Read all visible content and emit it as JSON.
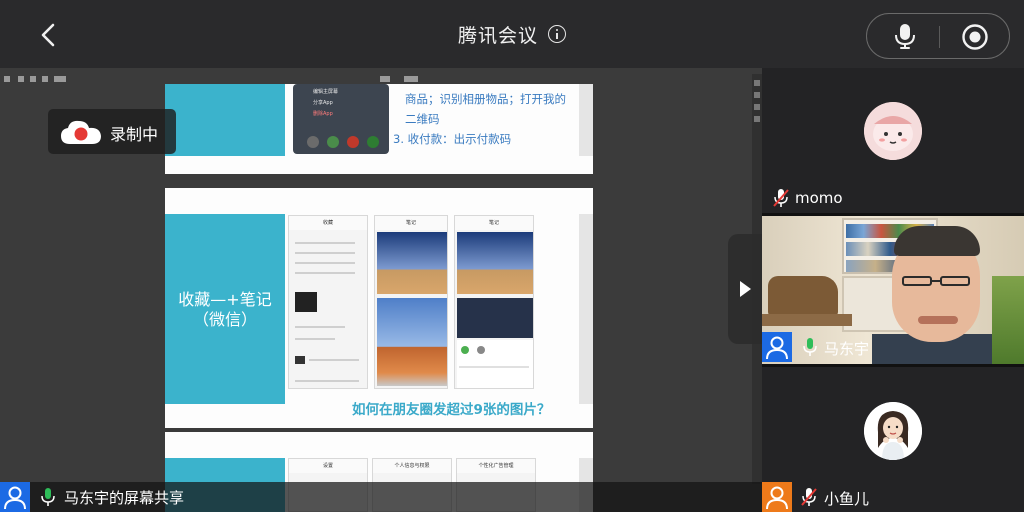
{
  "header": {
    "title": "腾讯会议",
    "back_icon": "chevron-left-icon",
    "info_icon": "info-icon",
    "mic_icon": "microphone-icon",
    "record_icon": "record-stop-icon"
  },
  "recording": {
    "label": "录制中",
    "icon": "recording-cloud-icon",
    "accent": "#e53935"
  },
  "shared_slides": {
    "slide1": {
      "text_lines": [
        "商品；识别相册物品；打开我的",
        "二维码",
        "3. 收付款：出示付款码"
      ],
      "menu_items": [
        "编辑主屏幕",
        "分享App",
        "删除App"
      ]
    },
    "slide2": {
      "band_title_line1": "收藏—+笔记",
      "band_title_line2": "（微信）",
      "question": "如何在朋友圈发超过9张的图片？",
      "screen_headers": [
        "收藏",
        "笔记",
        "笔记"
      ]
    },
    "slide3": {
      "screen_headers": [
        "设置",
        "个人信息与权限",
        "个性化广告管理"
      ]
    },
    "accent_band": "#3bb3cc",
    "text_color": "#3a7bc0"
  },
  "share_bar": {
    "label": "马东宇的屏幕共享",
    "avatar_icon": "user-avatar-icon",
    "mic_icon": "microphone-on-icon"
  },
  "participants": [
    {
      "name": "momo",
      "mic_icon": "microphone-muted-icon",
      "avatar": "cartoon-avatar"
    },
    {
      "name": "马东宇",
      "mic_icon": "microphone-on-icon",
      "avatar": "user-avatar-icon",
      "video": true
    },
    {
      "name": "小鱼儿",
      "mic_icon": "microphone-muted-icon",
      "avatar": "cartoon-avatar"
    }
  ],
  "colors": {
    "topbar": "#2a2a2c",
    "blue_avatar": "#1c6ae4",
    "orange_avatar": "#ee7a1a",
    "mic_green": "#2ebd59",
    "mic_muted_red": "#e53935"
  }
}
